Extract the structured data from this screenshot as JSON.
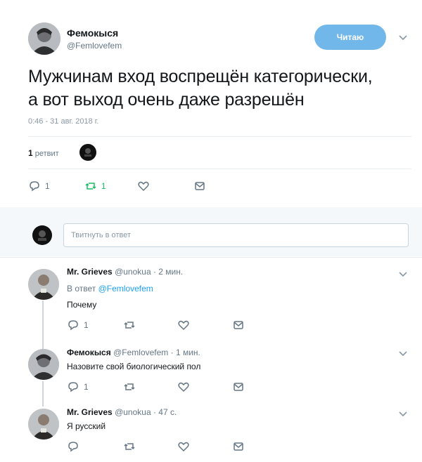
{
  "tweet": {
    "author_name": "Фемокыся",
    "author_handle": "@Femlovefem",
    "follow_label": "Читаю",
    "text_line1": "Мужчинам вход воспрещён категорически,",
    "text_line2": "а вот выход очень даже разрешён",
    "timestamp": "0:46 - 31 авг. 2018 г.",
    "retweets_number": "1",
    "retweets_label": "ретвит",
    "reply_count": "1",
    "retweet_count": "1"
  },
  "reply_box": {
    "placeholder": "Твитнуть в ответ"
  },
  "replies": [
    {
      "name": "Mr. Grieves",
      "handle_time": "@unokua · 2 мин.",
      "context_prefix": "В ответ ",
      "context_handle": "@Femlovefem",
      "text": "Почему",
      "reply_count": "1"
    },
    {
      "name": "Фемокыся",
      "handle_time": "@Femlovefem · 1 мин.",
      "text": "Назовите свой биологический пол",
      "reply_count": "1"
    },
    {
      "name": "Mr. Grieves",
      "handle_time": "@unokua · 47 с.",
      "text": "Я русский",
      "reply_count": ""
    }
  ],
  "colors": {
    "accent": "#1da1f2",
    "follow_button": "#71b7ea",
    "muted": "#657786",
    "retweet_green": "#17bf63"
  },
  "icons": [
    "reply-icon",
    "retweet-icon",
    "like-icon",
    "message-icon",
    "chevron-down-icon"
  ]
}
